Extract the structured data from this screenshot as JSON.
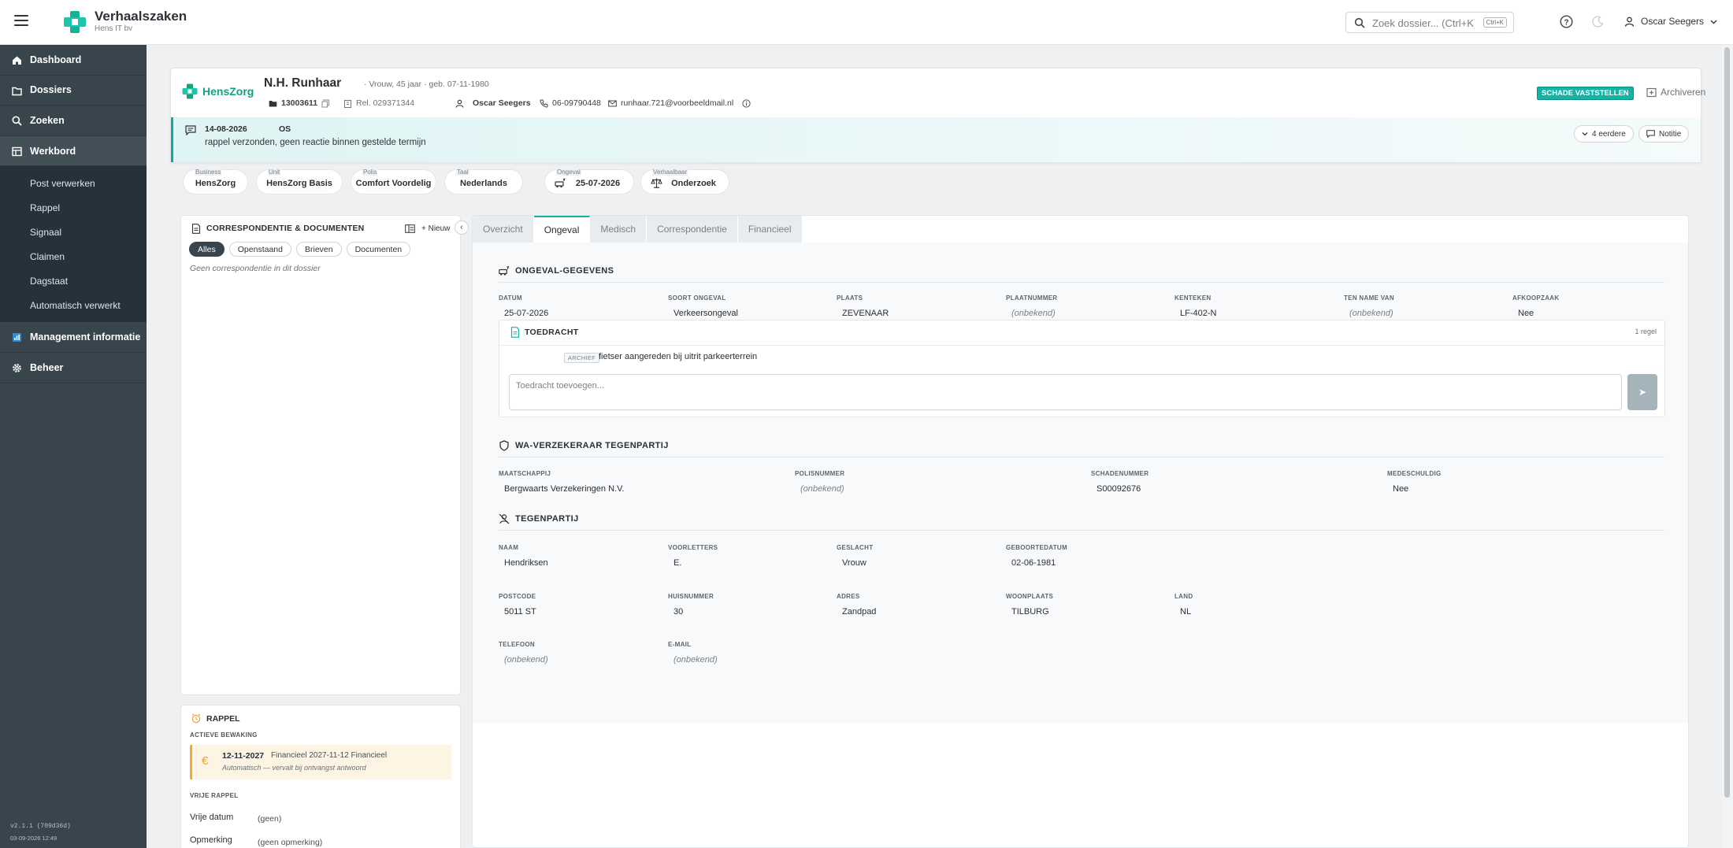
{
  "app": {
    "title": "Verhaalszaken",
    "subtitle": "Hens IT bv"
  },
  "search": {
    "placeholder": "Zoek dossier... (Ctrl+K)",
    "shortcut": "Ctrl+K"
  },
  "user": {
    "name": "Oscar Seegers"
  },
  "sidebar": {
    "items": [
      {
        "label": "Dashboard",
        "icon": "home-icon"
      },
      {
        "label": "Dossiers",
        "icon": "folder-icon"
      },
      {
        "label": "Zoeken",
        "icon": "search-icon"
      },
      {
        "label": "Werkbord",
        "icon": "board-icon"
      }
    ],
    "subitems": [
      "Post verwerken",
      "Rappel",
      "Signaal",
      "Claimen",
      "Dagstaat",
      "Automatisch verwerkt"
    ],
    "bottom_items": [
      {
        "label": "Management informatie",
        "icon": "chart-icon"
      },
      {
        "label": "Beheer",
        "icon": "gear-icon"
      }
    ],
    "version": "v2.1.1 (709d36d)",
    "version_date": "03-09-2026 12:49"
  },
  "header": {
    "brand": "HensZorg",
    "person_name": "N.H. Runhaar",
    "person_detail": "· Vrouw, 45 jaar · geb. 07-11-1980",
    "dossier": "13003611",
    "relation": "Rel. 029371344",
    "handler": "Oscar Seegers",
    "phone": "06-09790448",
    "email": "runhaar.721@voorbeeldmail.nl",
    "status_badge": "SCHADE VASTSTELLEN",
    "archive": "Archiveren"
  },
  "note": {
    "date": "14-08-2026",
    "initials": "OS",
    "text": "rappel verzonden, geen reactie binnen gestelde termijn",
    "earlier": "4 eerdere",
    "add_note": "Notitie"
  },
  "chips": [
    {
      "label": "Business",
      "value": "HensZorg"
    },
    {
      "label": "Unit",
      "value": "HensZorg Basis"
    },
    {
      "label": "Polis",
      "value": "Comfort Voordelig"
    },
    {
      "label": "Taal",
      "value": "Nederlands"
    },
    {
      "label": "Ongeval",
      "value": "25-07-2026"
    },
    {
      "label": "Verhaalbaar",
      "value": "Onderzoek"
    }
  ],
  "correspondence": {
    "title": "CORRESPONDENTIE & DOCUMENTEN",
    "new_label": "+ Nieuw",
    "filters": [
      "Alles",
      "Openstaand",
      "Brieven",
      "Documenten"
    ],
    "empty": "Geen correspondentie in dit dossier"
  },
  "rappel": {
    "title": "RAPPEL",
    "active_label": "ACTIEVE BEWAKING",
    "item_date": "12-11-2027",
    "item_desc": "Financieel 2027-11-12 Financieel",
    "item_note": "Automatisch — vervalt bij ontvangst antwoord",
    "free_label": "VRIJE RAPPEL",
    "date_label": "Vrije datum",
    "date_value": "(geen)",
    "remark_label": "Opmerking",
    "remark_value": "(geen opmerking)"
  },
  "tabs": [
    "Overzicht",
    "Ongeval",
    "Medisch",
    "Correspondentie",
    "Financieel"
  ],
  "ongeval": {
    "title": "ONGEVAL-GEGEVENS",
    "fields": [
      {
        "label": "DATUM",
        "value": "25-07-2026",
        "unknown": false
      },
      {
        "label": "SOORT ONGEVAL",
        "value": "Verkeersongeval",
        "unknown": false
      },
      {
        "label": "PLAATS",
        "value": "ZEVENAAR",
        "unknown": false
      },
      {
        "label": "PLAATNUMMER",
        "value": "(onbekend)",
        "unknown": true
      },
      {
        "label": "KENTEKEN",
        "value": "LF-402-N",
        "unknown": false
      },
      {
        "label": "TEN NAME VAN",
        "value": "(onbekend)",
        "unknown": true
      },
      {
        "label": "AFKOOPZAAK",
        "value": "Nee",
        "unknown": false
      }
    ]
  },
  "toedracht": {
    "title": "TOEDRACHT",
    "count": "1 regel",
    "tag": "ARCHIEF",
    "text": "fietser aangereden bij uitrit parkeerterrein",
    "placeholder": "Toedracht toevoegen...",
    "send": "➤"
  },
  "wa": {
    "title": "WA-VERZEKERAAR TEGENPARTIJ",
    "fields": [
      {
        "label": "MAATSCHAPPIJ",
        "value": "Bergwaarts Verzekeringen N.V.",
        "unknown": false
      },
      {
        "label": "POLISNUMMER",
        "value": "(onbekend)",
        "unknown": true
      },
      {
        "label": "SCHADENUMMER",
        "value": "S00092676",
        "unknown": false
      },
      {
        "label": "MEDESCHULDIG",
        "value": "Nee",
        "unknown": false
      }
    ]
  },
  "tegenpartij": {
    "title": "TEGENPARTIJ",
    "fields": [
      {
        "label": "NAAM",
        "value": "Hendriksen",
        "unknown": false
      },
      {
        "label": "VOORLETTERS",
        "value": "E.",
        "unknown": false
      },
      {
        "label": "GESLACHT",
        "value": "Vrouw",
        "unknown": false
      },
      {
        "label": "GEBOORTEDATUM",
        "value": "02-06-1981",
        "unknown": false
      },
      {
        "label": "POSTCODE",
        "value": "5011 ST",
        "unknown": false
      },
      {
        "label": "HUISNUMMER",
        "value": "30",
        "unknown": false
      },
      {
        "label": "ADRES",
        "value": "Zandpad",
        "unknown": false
      },
      {
        "label": "WOONPLAATS",
        "value": "TILBURG",
        "unknown": false
      },
      {
        "label": "LAND",
        "value": "NL",
        "unknown": false
      },
      {
        "label": "TELEFOON",
        "value": "(onbekend)",
        "unknown": true
      },
      {
        "label": "E-MAIL",
        "value": "(onbekend)",
        "unknown": true
      }
    ]
  },
  "colors": {
    "sidebar": "#39454d",
    "accent": "#14b3a5",
    "brand": "#16a080",
    "warning": "#f0a93a"
  }
}
